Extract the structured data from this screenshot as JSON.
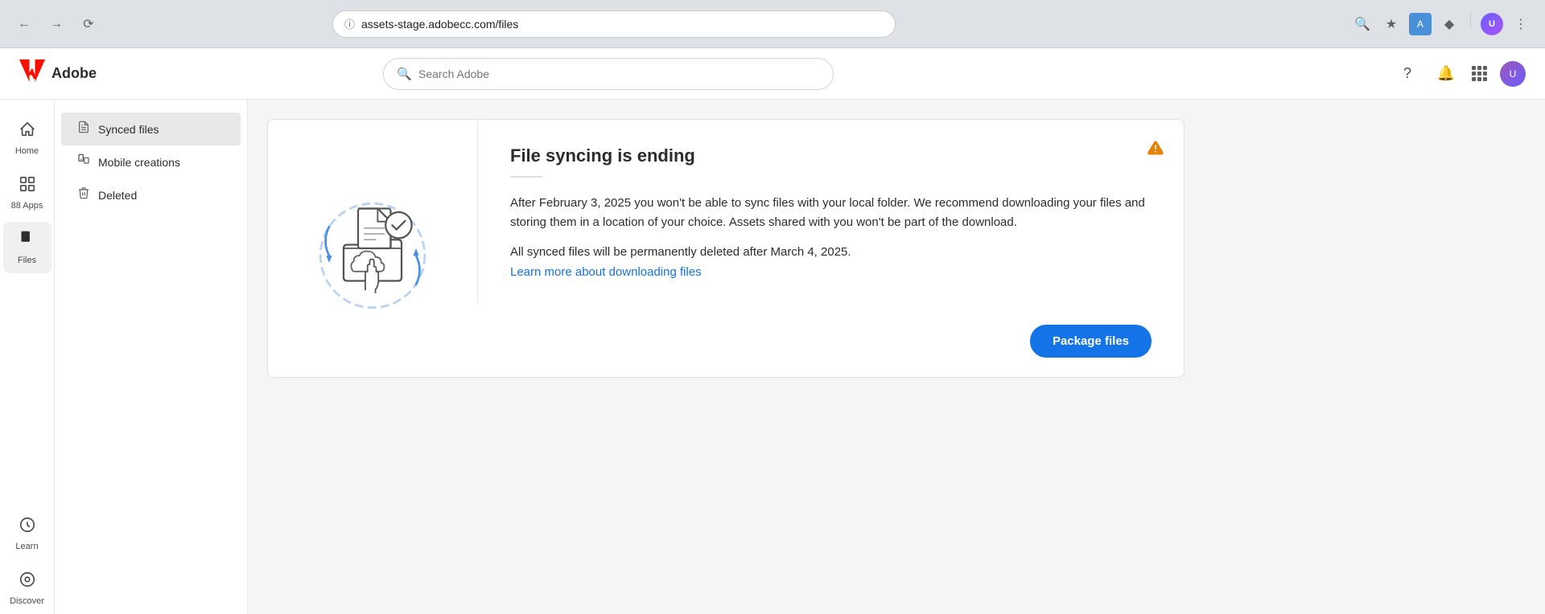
{
  "browser": {
    "url": "assets-stage.adobecc.com/files",
    "back_title": "Back",
    "forward_title": "Forward",
    "reload_title": "Reload"
  },
  "header": {
    "logo_text": "Adobe",
    "search_placeholder": "Search Adobe"
  },
  "icon_nav": {
    "items": [
      {
        "id": "home",
        "label": "Home",
        "icon": "⌂",
        "active": false
      },
      {
        "id": "apps",
        "label": "Apps",
        "icon": "⊞",
        "active": false
      },
      {
        "id": "files",
        "label": "Files",
        "icon": "□",
        "active": true
      },
      {
        "id": "learn",
        "label": "Learn",
        "icon": "◎",
        "active": false
      },
      {
        "id": "discover",
        "label": "Discover",
        "icon": "◉",
        "active": false
      }
    ]
  },
  "sidebar": {
    "items": [
      {
        "id": "synced-files",
        "label": "Synced files",
        "icon": "📄",
        "active": true
      },
      {
        "id": "mobile-creations",
        "label": "Mobile creations",
        "icon": "📋",
        "active": false
      },
      {
        "id": "deleted",
        "label": "Deleted",
        "icon": "🗑",
        "active": false
      }
    ]
  },
  "notice": {
    "title": "File syncing is ending",
    "divider": true,
    "body_text": "After February 3, 2025 you won't be able to sync files with your local folder. We recommend downloading your files and storing them in a location of your choice. Assets shared with you won't be part of the download.",
    "sub_text": "All synced files will be permanently deleted after March 4, 2025.",
    "link_text": "Learn more about downloading files",
    "link_url": "#",
    "warning_icon": "⚠",
    "package_button_label": "Package files"
  }
}
